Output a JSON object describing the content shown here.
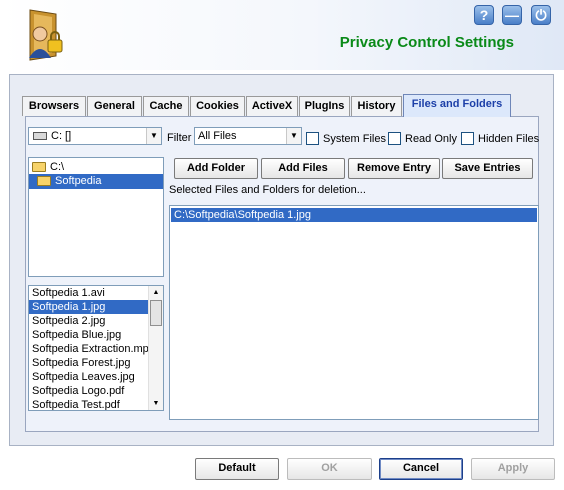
{
  "header": {
    "title": "Privacy Control Settings",
    "help_label": "?",
    "minimize_label": "—",
    "power_label": "⏻",
    "logo_icon": "privacy-shield-logo-icon"
  },
  "tabs": [
    {
      "label": "Browsers"
    },
    {
      "label": "General"
    },
    {
      "label": "Cache"
    },
    {
      "label": "Cookies"
    },
    {
      "label": "ActiveX"
    },
    {
      "label": "PlugIns"
    },
    {
      "label": "History"
    },
    {
      "label": "Files and Folders",
      "active": true
    }
  ],
  "drive": {
    "value": "C: []"
  },
  "filter": {
    "label": "Filter",
    "value": "All Files"
  },
  "checkboxes": {
    "system_files": "System Files",
    "read_only": "Read Only",
    "hidden_files": "Hidden Files"
  },
  "folder_tree": [
    {
      "label": "C:\\"
    },
    {
      "label": "Softpedia",
      "selected": true
    }
  ],
  "file_list": [
    {
      "label": "Softpedia 1.avi"
    },
    {
      "label": "Softpedia 1.jpg",
      "selected": true
    },
    {
      "label": "Softpedia 2.jpg"
    },
    {
      "label": "Softpedia Blue.jpg"
    },
    {
      "label": "Softpedia Extraction.mp"
    },
    {
      "label": "Softpedia Forest.jpg"
    },
    {
      "label": "Softpedia Leaves.jpg"
    },
    {
      "label": "Softpedia Logo.pdf"
    },
    {
      "label": "Softpedia Test.pdf"
    }
  ],
  "actions": {
    "add_folder": "Add Folder",
    "add_files": "Add Files",
    "remove_entry": "Remove Entry",
    "save_entries": "Save Entries"
  },
  "selected_label": "Selected Files and Folders for deletion...",
  "selected_list": [
    {
      "label": "C:\\Softpedia\\Softpedia 1.jpg",
      "selected": true
    }
  ],
  "footer": {
    "default": "Default",
    "ok": "OK",
    "cancel": "Cancel",
    "apply": "Apply"
  },
  "colors": {
    "title_green": "#0a8a18",
    "selection_blue": "#316ac5",
    "active_tab_text": "#1c3fa8"
  }
}
